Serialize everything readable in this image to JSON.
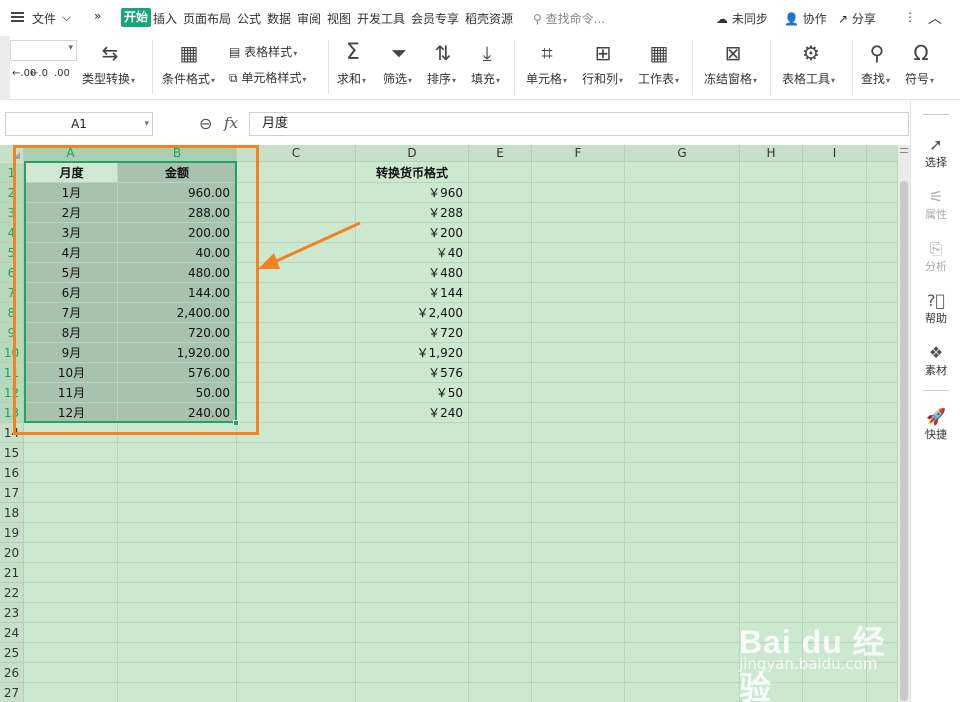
{
  "menu": {
    "file": "文件",
    "tabs": [
      "开始",
      "插入",
      "页面布局",
      "公式",
      "数据",
      "审阅",
      "视图",
      "开发工具",
      "会员专享",
      "稻壳资源"
    ],
    "search_placeholder": "查找命令...",
    "sync": "未同步",
    "collab": "协作",
    "share": "分享"
  },
  "ribbon": {
    "type_convert": "类型转换",
    "cond_format": "条件格式",
    "table_style": "表格样式",
    "cell_style": "单元格样式",
    "sum": "求和",
    "filter": "筛选",
    "sort": "排序",
    "fill": "填充",
    "cell": "单元格",
    "row_col": "行和列",
    "worksheet": "工作表",
    "freeze": "冻结窗格",
    "table_tools": "表格工具",
    "find": "查找",
    "symbol": "符号",
    "decimal_add": ".00",
    "decimal_remove": ".0"
  },
  "formula_bar": {
    "name_box": "A1",
    "fx": "fx",
    "content": "月度"
  },
  "right_panel": {
    "select": "选择",
    "properties": "属性",
    "analyze": "分析",
    "help": "帮助",
    "material": "素材",
    "quick": "快捷"
  },
  "columns": [
    "A",
    "B",
    "C",
    "D",
    "E",
    "F",
    "G",
    "H",
    "I"
  ],
  "rows": [
    "1",
    "2",
    "3",
    "4",
    "5",
    "6",
    "7",
    "8",
    "9",
    "10",
    "11",
    "12",
    "13",
    "14",
    "15",
    "16",
    "17",
    "18",
    "19",
    "20",
    "21",
    "22",
    "23",
    "24",
    "25",
    "26",
    "27"
  ],
  "sheet": {
    "header_a": "月度",
    "header_b": "金额",
    "header_d": "转换货币格式",
    "months": [
      "1月",
      "2月",
      "3月",
      "4月",
      "5月",
      "6月",
      "7月",
      "8月",
      "9月",
      "10月",
      "11月",
      "12月"
    ],
    "amounts": [
      "960.00",
      "288.00",
      "200.00",
      "40.00",
      "480.00",
      "144.00",
      "2,400.00",
      "720.00",
      "1,920.00",
      "576.00",
      "50.00",
      "240.00"
    ],
    "currency": [
      "￥960",
      "￥288",
      "￥200",
      "￥40",
      "￥480",
      "￥144",
      "￥2,400",
      "￥720",
      "￥1,920",
      "￥576",
      "￥50",
      "￥240"
    ]
  },
  "watermark": {
    "brand": "Bai du 经验",
    "url": "jingyan.baidu.com"
  },
  "colors": {
    "accent": "#17a57b",
    "annotation": "#f5821f",
    "sheet_bg": "#cce8cf"
  }
}
